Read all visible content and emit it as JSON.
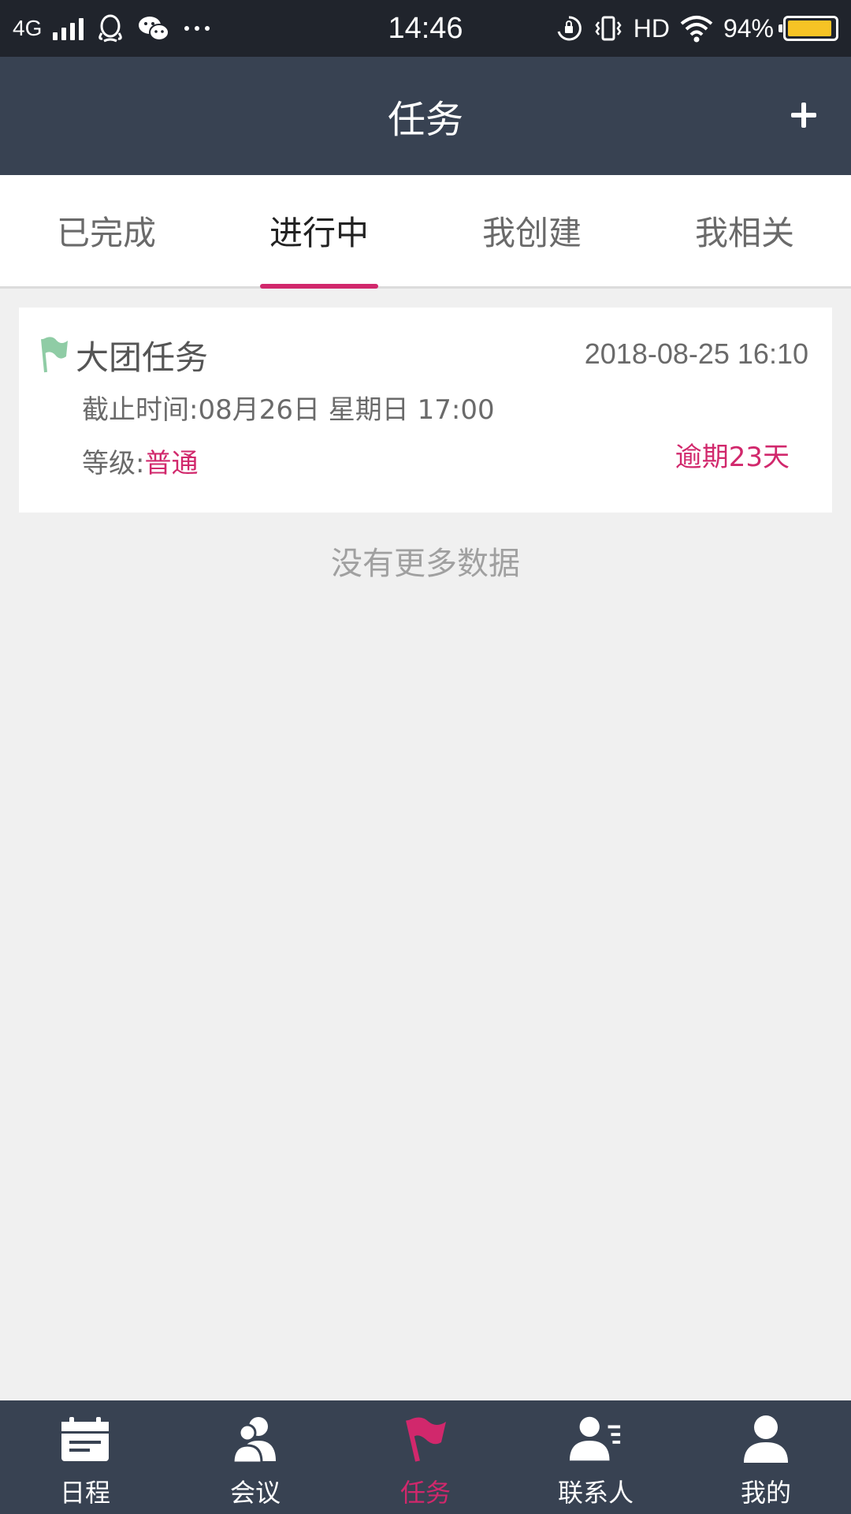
{
  "status_bar": {
    "network": "4G",
    "time": "14:46",
    "hd": "HD",
    "battery": "94%",
    "battery_level": 0.94,
    "icons": [
      "signal-icon",
      "qq-icon",
      "wechat-icon",
      "more-icon",
      "rotation-lock-icon",
      "vibrate-icon",
      "wifi-icon",
      "battery-icon"
    ]
  },
  "header": {
    "title": "任务",
    "add_icon": "plus-icon"
  },
  "tabs": [
    {
      "label": "已完成",
      "active": false
    },
    {
      "label": "进行中",
      "active": true
    },
    {
      "label": "我创建",
      "active": false
    },
    {
      "label": "我相关",
      "active": false
    }
  ],
  "task": {
    "title": "大团任务",
    "created": "2018-08-25 16:10",
    "deadline": "截止时间:08月26日 星期日 17:00",
    "level_label": "等级:",
    "level_value": "普通",
    "overdue": "逾期23天",
    "flag_color": "#8fcca5"
  },
  "list_footer": "没有更多数据",
  "bottom_nav": [
    {
      "label": "日程",
      "icon": "calendar-icon",
      "active": false
    },
    {
      "label": "会议",
      "icon": "meeting-icon",
      "active": false
    },
    {
      "label": "任务",
      "icon": "flag-icon",
      "active": true
    },
    {
      "label": "联系人",
      "icon": "contacts-icon",
      "active": false
    },
    {
      "label": "我的",
      "icon": "profile-icon",
      "active": false
    }
  ],
  "colors": {
    "accent": "#d1286c",
    "header_bg": "#384252",
    "status_bg": "#20242c",
    "page_bg": "#f0f0f0"
  }
}
